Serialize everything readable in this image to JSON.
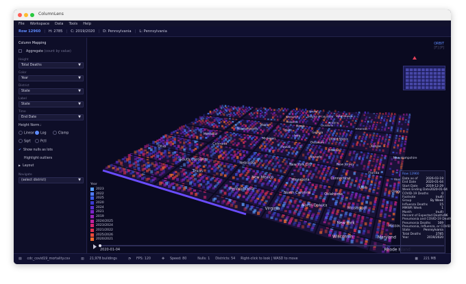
{
  "window": {
    "title": "ColumnLens"
  },
  "menu": [
    "File",
    "Workspace",
    "Data",
    "Tools",
    "Help"
  ],
  "infobar": {
    "row": "Row 12960",
    "height": "H: 2785",
    "color": "C: 2019/2020",
    "district": "D: Pennsylvania",
    "label": "L: Pennsylvania"
  },
  "sidebar": {
    "header": "Column Mapping",
    "aggregate_label": "Aggregate",
    "aggregate_hint": "(count by value)",
    "height_label": "Height",
    "height_value": "Total Deaths",
    "color_label": "Color",
    "color_value": "Year",
    "district_label": "District",
    "district_value": "State",
    "label_label": "Label",
    "label_value": "State",
    "time_label": "Time",
    "time_value": "End Date",
    "norm_header": "Height Norm.:",
    "norm": [
      "Linear",
      "Log",
      "Clamp",
      "Sqrt",
      "Pctl"
    ],
    "norm_selected": "Log",
    "show_nulls": "Show nulls as lots",
    "highlight": "Highlight outliers",
    "layout": "Layout",
    "navigate_label": "Navigate",
    "navigate_value": "(select district)"
  },
  "viewport": {
    "orbit": "ORBIT",
    "orbit_sub": "[F] [P]",
    "states": [
      "Florida",
      "West Virginia",
      "District of Columbia",
      "Kentucky",
      "Arizona",
      "Alabama",
      "Louisiana",
      "Illinois",
      "Arkansas",
      "Maine",
      "Idaho",
      "Georgia",
      "United States",
      "Iowa",
      "Delaware",
      "Massachusetts",
      "Michigan",
      "Indiana",
      "Kansas",
      "New Hampshire",
      "Montana",
      "Hawaii",
      "Nevada",
      "New Jersey",
      "Florida",
      "Vermont",
      "Colorado",
      "New York City",
      "Connecticut",
      "Oregon",
      "Utah",
      "Nebraska",
      "Ohio",
      "Minnesota",
      "South Carolina",
      "New Mexico",
      "Oklahoma",
      "Texas",
      "North Carolina",
      "Mississippi",
      "North Dakota",
      "Pennsylvania",
      "New York",
      "Maryland",
      "Missouri",
      "Virginia",
      "Rhode Island",
      "Wisconsin"
    ],
    "legend_title": "Year",
    "legend": [
      {
        "label": "2023",
        "color": "#5aa0ff"
      },
      {
        "label": "2022",
        "color": "#4f7cff"
      },
      {
        "label": "2025",
        "color": "#3c5ae8"
      },
      {
        "label": "2020",
        "color": "#3b3bd0"
      },
      {
        "label": "2024",
        "color": "#5a2dd0"
      },
      {
        "label": "2021",
        "color": "#7a25c8"
      },
      {
        "label": "2019",
        "color": "#9a22b8"
      },
      {
        "label": "2024/2025",
        "color": "#c223a0"
      },
      {
        "label": "2023/2024",
        "color": "#d8246f"
      },
      {
        "label": "2021/2022",
        "color": "#e0304d"
      },
      {
        "label": "2025/2026",
        "color": "#e84a3a"
      },
      {
        "label": "2020/2021",
        "color": "#f06a2f"
      }
    ],
    "timeline_date": "2020-01-04"
  },
  "tooltip": {
    "header": "Row 12960",
    "rows": [
      {
        "k": "Data as of",
        "v": "2026-03-19"
      },
      {
        "k": "End Date",
        "v": "2020-01-04"
      },
      {
        "k": "Start Date",
        "v": "2019-12-29"
      },
      {
        "k": "Week Ending Date",
        "v": "2020-01-04"
      },
      {
        "k": "COVID-19 Deaths",
        "v": "0"
      },
      {
        "k": "Footnote",
        "v": "(null)"
      },
      {
        "k": "Group",
        "v": "By Week"
      },
      {
        "k": "Influenza Deaths",
        "v": "15"
      },
      {
        "k": "MMWR Week",
        "v": "1"
      },
      {
        "k": "Month",
        "v": "(null)"
      },
      {
        "k": "Percent of Expected Deaths",
        "v": "96"
      },
      {
        "k": "Pneumonia and COVID-19 Deaths",
        "v": "0"
      },
      {
        "k": "Pneumonia Deaths",
        "v": "169"
      },
      {
        "k": "Pneumonia, Influenza, or COVID",
        "v": "184"
      },
      {
        "k": "State",
        "v": "Pennsylvania"
      },
      {
        "k": "Total Deaths",
        "v": "2785"
      },
      {
        "k": "Year",
        "v": "2019/2020"
      }
    ]
  },
  "status": {
    "file": "cdc_covid19_mortality.csv",
    "buildings": "21,978 buildings",
    "fps": "FPS: 120",
    "speed": "Speed: 80",
    "nulls": "Nulls: 1",
    "districts": "Districts: 54",
    "hint": "Right-click to look | WASD to move",
    "memory": "221 MB"
  },
  "colors": {
    "accent": "#5f8cff",
    "bg": "#0c0c24"
  }
}
